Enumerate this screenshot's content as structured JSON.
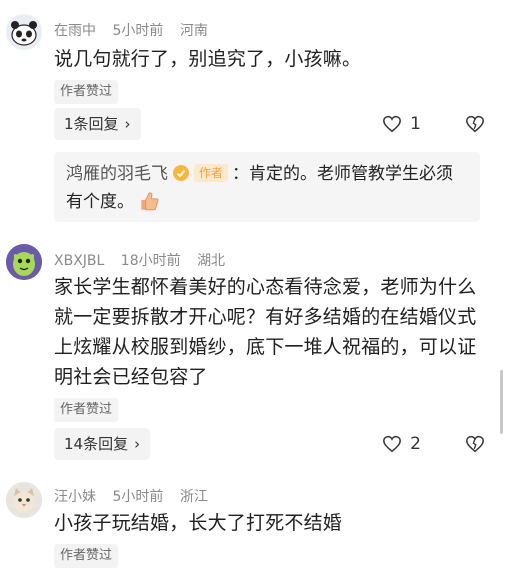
{
  "comments": [
    {
      "user": "在雨中",
      "time": "5小时前",
      "location": "河南",
      "text": "说几句就行了，别追究了，小孩嘛。",
      "author_liked": "作者赞过",
      "replies_label": "1条回复",
      "likes": "1",
      "sub_reply": {
        "name": "鸿雁的羽毛飞",
        "tag": "作者",
        "text": "：肯定的。老师管教学生必须有个度。"
      }
    },
    {
      "user": "XBXJBL",
      "time": "18小时前",
      "location": "湖北",
      "text": "家长学生都怀着美好的心态看待念爱，老师为什么就一定要拆散才开心呢？有好多结婚的在结婚仪式上炫耀从校服到婚纱，底下一堆人祝福的，可以证明社会已经包容了",
      "author_liked": "作者赞过",
      "replies_label": "14条回复",
      "likes": "2"
    },
    {
      "user": "汪小妹",
      "time": "5小时前",
      "location": "浙江",
      "text": "小孩子玩结婚，长大了打死不结婚",
      "author_liked": "作者赞过"
    }
  ],
  "icons": {
    "like": "heart-outline-icon",
    "dislike": "broken-heart-icon",
    "chevron": "chevron-right-icon"
  },
  "colors": {
    "meta": "#8a8a8a",
    "author_tag": "#f3a33a",
    "chip_bg": "#f3f3f3"
  }
}
